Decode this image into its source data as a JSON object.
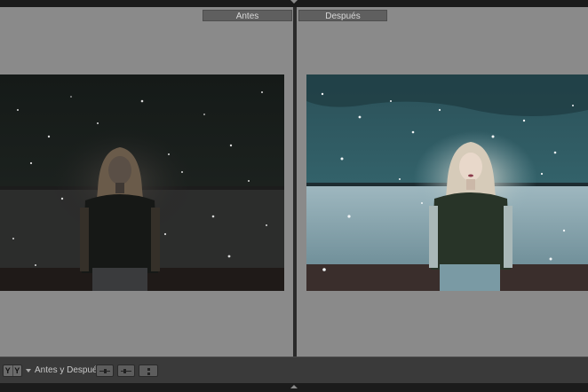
{
  "panes": {
    "before_label": "Antes",
    "after_label": "Después"
  },
  "toolbar": {
    "view_mode_icon": "YY",
    "view_mode_caret": "chevron-down-icon",
    "before_after_label": "Antes y Después:",
    "copy_buttons": [
      "copy-before-to-after-icon",
      "copy-after-to-before-icon",
      "swap-before-after-icon"
    ]
  },
  "colors": {
    "pane_background": "#8a8a8a",
    "toolbar_background": "#3a3a3a",
    "label_background": "#5f5f5f"
  }
}
